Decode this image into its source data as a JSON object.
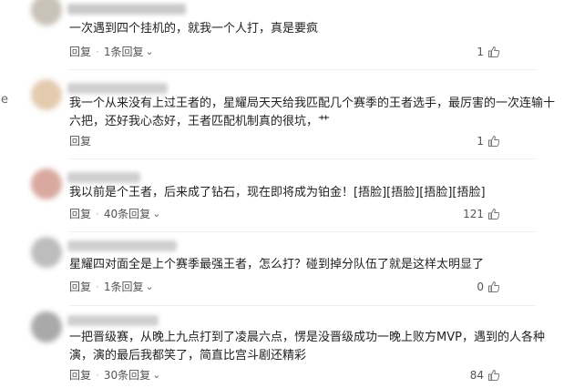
{
  "stray_char": "e",
  "comments": [
    {
      "text_lines": [
        "一次遇到四个挂机的，就我一个人打，真是要疯"
      ],
      "reply_label": "回复",
      "sub_replies": "1条回复",
      "likes": "1"
    },
    {
      "text_lines": [
        "我一个从来没有上过王者的，星耀局天天给我匹配几个赛季的王者选手，最厉害的一次连输十",
        "六把，还好我心态好，王者匹配机制真的很坑，艹"
      ],
      "reply_label": "回复",
      "sub_replies": "",
      "likes": "1"
    },
    {
      "text_lines": [
        "我以前是个王者，后来成了钻石，现在即将成为铂金！[捂脸][捂脸][捂脸][捂脸]"
      ],
      "reply_label": "回复",
      "sub_replies": "40条回复",
      "likes": "121"
    },
    {
      "text_lines": [
        "星耀四对面全是上个赛季最强王者，怎么打？碰到掉分队伍了就是这样太明显了"
      ],
      "reply_label": "回复",
      "sub_replies": "1条回复",
      "likes": "0"
    },
    {
      "text_lines": [
        "一把晋级赛，从晚上九点打到了凌晨六点，愣是没晋级成功一晚上败方MVP，遇到的人各种",
        "演，演的最后我都笑了，简直比宫斗剧还精彩"
      ],
      "reply_label": "回复",
      "sub_replies": "30条回复",
      "likes": "84"
    }
  ]
}
